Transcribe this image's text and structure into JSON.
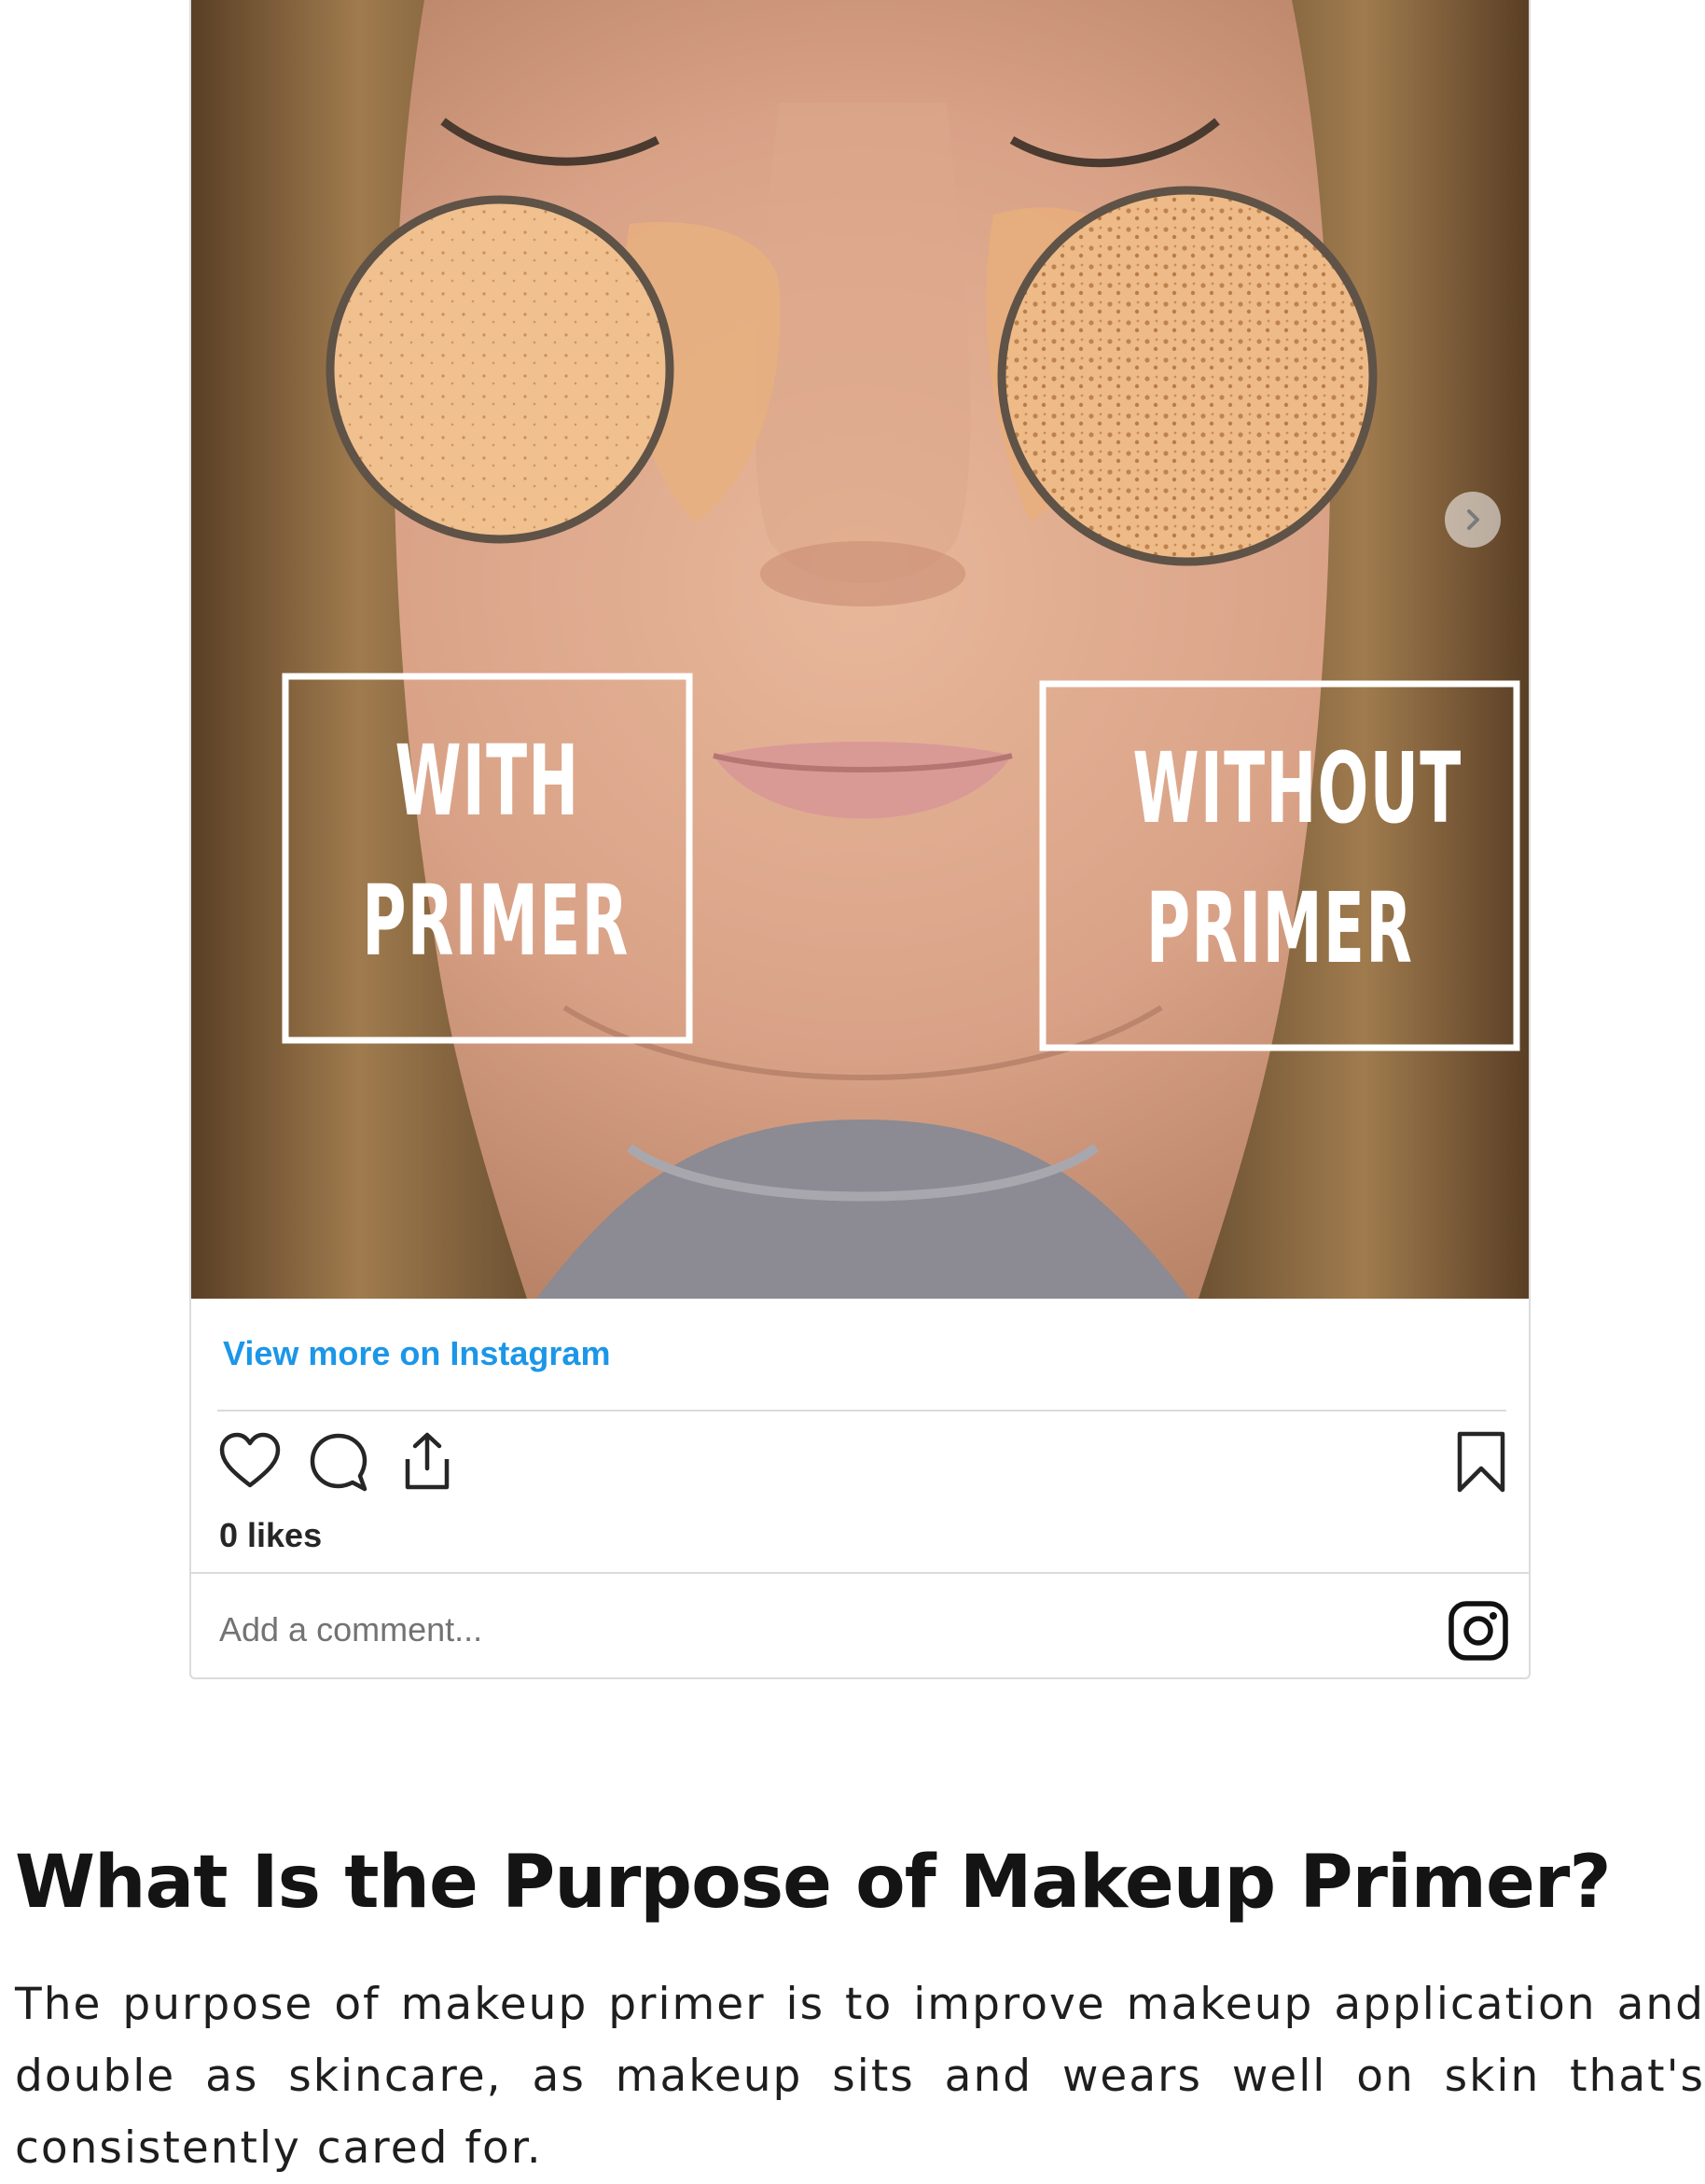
{
  "instagram_embed": {
    "overlay_left": [
      "WITH",
      "PRIMER"
    ],
    "overlay_right": [
      "WITHOUT",
      "PRIMER"
    ],
    "view_more_label": "View more on Instagram",
    "likes_label": "0 likes",
    "comment_placeholder": "Add a comment...",
    "link_color": "#1c96e8"
  },
  "article": {
    "heading": "What Is the Purpose of Makeup Primer?",
    "paragraph": "The purpose of makeup primer is to improve makeup application and double as skincare, as makeup sits and wears well on skin that's consistently cared for."
  }
}
